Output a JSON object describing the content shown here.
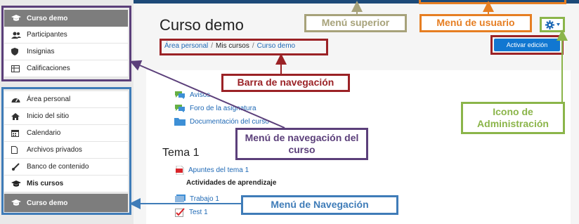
{
  "course_nav": {
    "items": [
      {
        "label": "Curso demo",
        "icon": "graduation-cap-icon"
      },
      {
        "label": "Participantes",
        "icon": "users-icon"
      },
      {
        "label": "Insignias",
        "icon": "shield-icon"
      },
      {
        "label": "Calificaciones",
        "icon": "table-icon"
      }
    ]
  },
  "main_nav": {
    "items": [
      {
        "label": "Área personal",
        "icon": "dashboard-icon"
      },
      {
        "label": "Inicio del sitio",
        "icon": "home-icon"
      },
      {
        "label": "Calendario",
        "icon": "calendar-icon"
      },
      {
        "label": "Archivos privados",
        "icon": "file-icon"
      },
      {
        "label": "Banco de contenido",
        "icon": "brush-icon"
      },
      {
        "label": "Mis cursos",
        "icon": "graduation-cap-icon"
      },
      {
        "label": "Curso demo",
        "icon": "graduation-cap-icon"
      }
    ]
  },
  "header": {
    "course_title": "Curso demo",
    "breadcrumb": [
      "Área personal",
      "Mis cursos",
      "Curso demo"
    ],
    "edit_button": "Activar edición"
  },
  "content": {
    "general_activities": [
      {
        "label": "Avisos",
        "icon": "forum-icon"
      },
      {
        "label": "Foro de la asignatura",
        "icon": "forum-icon"
      },
      {
        "label": "Documentación del curso",
        "icon": "folder-icon"
      }
    ],
    "section_title": "Tema 1",
    "section_items": [
      {
        "label": "Apuntes del tema 1",
        "icon": "pdf-icon"
      }
    ],
    "section_label": "Actividades de aprendizaje",
    "section_items_2": [
      {
        "label": "Trabajo 1",
        "icon": "assignment-icon"
      },
      {
        "label": "Test 1",
        "icon": "quiz-icon"
      }
    ]
  },
  "callouts": {
    "menu_superior": "Menú superior",
    "menu_usuario": "Menú de usuario",
    "barra_navegacion": "Barra de navegación",
    "icono_admin": "Icono de Administración",
    "menu_nav_curso": "Menú de navegación del curso",
    "menu_navegacion": "Menú de Navegación"
  },
  "colors": {
    "topbar": "#1d4a78",
    "link": "#1f69b5",
    "button": "#1177d1",
    "callout_tan": "#a7a27a",
    "callout_orange": "#e67e22",
    "callout_red": "#9b2226",
    "callout_green": "#8bb54a",
    "callout_purple": "#5b3f7a",
    "callout_blue": "#3f7cb8"
  }
}
